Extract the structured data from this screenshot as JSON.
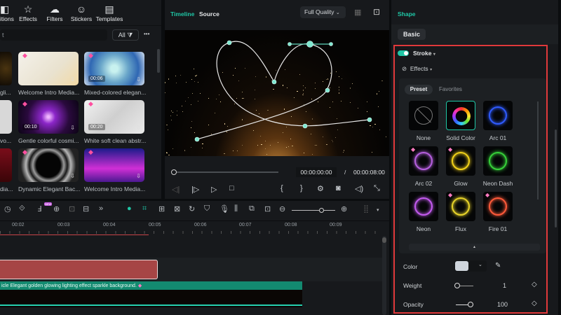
{
  "library": {
    "tabs": [
      {
        "label": "itions",
        "icon": "transitions-icon"
      },
      {
        "label": "Effects",
        "icon": "effects-icon"
      },
      {
        "label": "Filters",
        "icon": "filters-icon"
      },
      {
        "label": "Stickers",
        "icon": "stickers-icon"
      },
      {
        "label": "Templates",
        "icon": "templates-icon"
      }
    ],
    "search_value": "t",
    "filter_label": "All",
    "more": "•••",
    "items": [
      {
        "title": "Welcome Intro Media...",
        "duration": "",
        "bg": "linear-gradient(135deg,#f4f1ea,#e9e2cf 60%,#f2d9a5)"
      },
      {
        "title": "Mixed-colored elegan...",
        "duration": "00:06",
        "bg": "radial-gradient(circle,#c8f1ef 10%,#6aa6c9 40%,#2f67b3 70%,#d9e4f0)"
      },
      {
        "title": "Gentle colorful cosmi...",
        "duration": "00:10",
        "bg": "radial-gradient(circle,#f0b6ff 3%,#8c26c9 20%,#2a0a3d 60%,#0b0414)"
      },
      {
        "title": "White soft clean abstr...",
        "duration": "00:20",
        "bg": "linear-gradient(135deg,#f2f2f2,#cfcfcf 50%,#eaeaea)"
      },
      {
        "title": "Dynamic Elegant Bac...",
        "duration": "",
        "bg": "radial-gradient(circle,#050505 35%,#9a9a9a 45%,#1a1a1a 55%,#b5b5b5 65%,#222 80%)"
      },
      {
        "title": "Welcome Intro Media...",
        "duration": "",
        "bg": "linear-gradient(180deg,#1b1b8a,#d02fd6 60%,#4a1990)"
      }
    ],
    "partial_labels": [
      "gli...",
      "vo...",
      "dia..."
    ]
  },
  "preview": {
    "tab_timeline": "Timeline",
    "tab_source": "Source",
    "quality": "Full Quality",
    "current_time": "00:00:00:00",
    "separator": "/",
    "total_time": "00:00:08:00",
    "progress": 0
  },
  "timeline": {
    "ruler": [
      "00:02",
      "00:03",
      "00:04",
      "00:05",
      "00:06",
      "00:07",
      "00:08",
      "00:09"
    ],
    "clip_title": "icle Elegant golden glowing lighting effect sparkle background.",
    "badge": "NEW"
  },
  "inspector": {
    "title": "Shape",
    "basic_tab": "Basic",
    "stroke_label": "Stroke",
    "stroke_on": true,
    "effects_label": "Effects",
    "preset_tab": "Preset",
    "favorites_tab": "Favorites",
    "presets": [
      {
        "name": "None",
        "color": "none"
      },
      {
        "name": "Solid Color",
        "color": "wheel",
        "selected": true
      },
      {
        "name": "Arc 01",
        "color": "#2f5bff"
      },
      {
        "name": "Arc 02",
        "color": "#b760e0",
        "premium": true
      },
      {
        "name": "Glow",
        "color": "#f2d21a",
        "premium": true
      },
      {
        "name": "Neon Dash",
        "color": "#37d13a"
      },
      {
        "name": "Neon",
        "color": "#c45bf0"
      },
      {
        "name": "Flux",
        "color": "#e8d42a",
        "premium": true
      },
      {
        "name": "Fire 01",
        "color": "#ff5a3a",
        "premium": true
      }
    ],
    "color_label": "Color",
    "color_value": "#cfd5dc",
    "weight_label": "Weight",
    "weight_value": "1",
    "opacity_label": "Opacity",
    "opacity_value": "100"
  },
  "colors": {
    "accent": "#1fc7a6",
    "highlight": "#e0393b"
  }
}
